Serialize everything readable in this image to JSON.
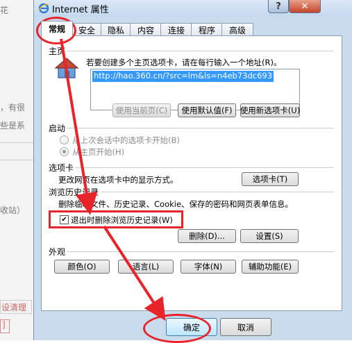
{
  "backdrop": {
    "fragments": [
      "花",
      "，有很",
      "些是系",
      "收站）",
      "设清理",
      "]"
    ]
  },
  "window": {
    "title": "Internet 属性",
    "help_glyph": "?",
    "close_glyph": "✕"
  },
  "tabs": [
    {
      "label": "常规"
    },
    {
      "label": "安全"
    },
    {
      "label": "隐私"
    },
    {
      "label": "内容"
    },
    {
      "label": "连接"
    },
    {
      "label": "程序"
    },
    {
      "label": "高级"
    }
  ],
  "homepage": {
    "label": "主页",
    "description": "若要创建多个主页选项卡，请在每行输入一个地址(R)。",
    "url": "http://hao.360.cn/?src=lm&ls=n4eb73dc693",
    "use_current": "使用当前页(C)",
    "use_default": "使用默认值(F)",
    "use_new_tab": "使用新选项卡(U)"
  },
  "startup": {
    "label": "启动",
    "option_last_session": "从上次会话中的选项卡开始(B)",
    "option_homepage": "从主页开始(H)"
  },
  "tabs_section": {
    "label": "选项卡",
    "description": "更改网页在选项卡中的显示方式。",
    "button": "选项卡(T)"
  },
  "history": {
    "label": "浏览历史记录",
    "description": "删除临时文件、历史记录、Cookie、保存的密码和网页表单信息。",
    "checkbox_label": "退出时删除浏览历史记录(W)",
    "checkbox_checked": true,
    "delete_button": "删除(D)...",
    "settings_button": "设置(S)"
  },
  "appearance": {
    "label": "外观",
    "colors": "颜色(O)",
    "languages": "语言(L)",
    "fonts": "字体(N)",
    "accessibility": "辅助功能(E)"
  },
  "footer": {
    "ok": "确定",
    "cancel": "取消"
  },
  "colors": {
    "annotation": "#e8232a",
    "selection": "#3399ff"
  }
}
